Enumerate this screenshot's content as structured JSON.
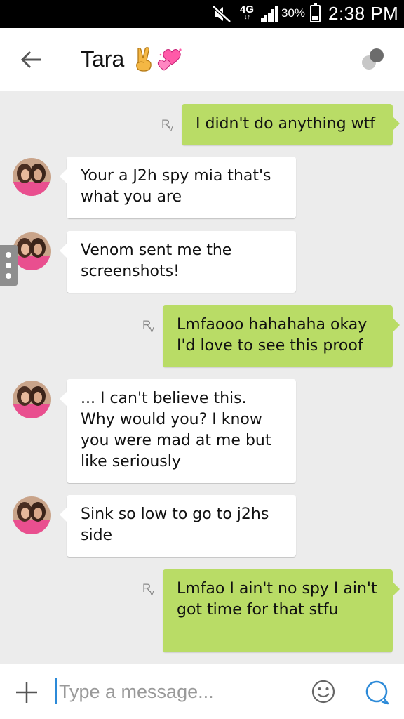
{
  "status_bar": {
    "network_type": "4G",
    "network_arrows": "↓↑",
    "battery_percent": "30%",
    "battery_level": 0.3,
    "time": "2:38 PM",
    "icons": [
      "mute-icon",
      "signal-icon",
      "battery-icon"
    ]
  },
  "header": {
    "contact_name": "Tara",
    "name_emojis": [
      "victory-hand-emoji",
      "two-hearts-emoji"
    ],
    "icons": [
      "back-arrow-icon",
      "options-icon"
    ]
  },
  "chat": {
    "read_receipt": "R",
    "read_receipt_sub": "v",
    "messages": [
      {
        "direction": "out",
        "text": "I didn't do anything wtf"
      },
      {
        "direction": "in",
        "text": "Your a J2h spy mia that's what you are"
      },
      {
        "direction": "in",
        "text": "Venom sent me the screenshots!"
      },
      {
        "direction": "out",
        "text": "Lmfaooo hahahaha okay I'd love to see this proof"
      },
      {
        "direction": "in",
        "text": "... I can't believe this. Why would you? I know you were mad at me but like seriously"
      },
      {
        "direction": "in",
        "text": "Sink so low to go to j2hs side"
      },
      {
        "direction": "out",
        "text": "Lmfao I ain't no spy I ain't got time for that stfu"
      }
    ]
  },
  "input_bar": {
    "placeholder": "Type a message...",
    "value": "",
    "icons": [
      "plus-icon",
      "smiley-icon",
      "send-icon"
    ]
  },
  "colors": {
    "outgoing_bubble": "#b9dc66",
    "incoming_bubble": "#ffffff",
    "chat_background": "#ececec",
    "status_bar": "#000000",
    "accent": "#2c8ad8"
  }
}
